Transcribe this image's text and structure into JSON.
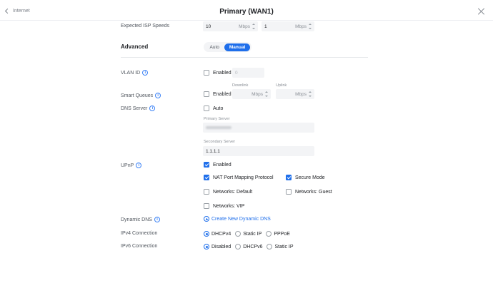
{
  "header": {
    "back_label": "Internet",
    "title": "Primary (WAN1)"
  },
  "isp": {
    "label": "Expected ISP Speeds",
    "download_value": "10",
    "download_unit": "Mbps",
    "upload_value": "1",
    "upload_unit": "Mbps"
  },
  "advanced": {
    "heading": "Advanced",
    "options": [
      "Auto",
      "Manual"
    ],
    "selected": "Manual"
  },
  "vlan": {
    "label": "VLAN ID",
    "enabled_label": "Enabled",
    "enabled": false,
    "value": "0"
  },
  "smart_queues": {
    "label": "Smart Queues",
    "enabled_label": "Enabled",
    "enabled": false,
    "download_label": "Downlink",
    "upload_label": "Uplink",
    "unit": "Mbps"
  },
  "dns": {
    "label": "DNS Server",
    "auto_label": "Auto",
    "auto": false,
    "primary_label": "Primary Server",
    "primary_value": "",
    "secondary_label": "Secondary Server",
    "secondary_value": "1.1.1.1"
  },
  "upnp": {
    "label": "UPnP",
    "enabled_label": "Enabled",
    "enabled": true,
    "options": [
      {
        "label": "NAT Port Mapping Protocol",
        "checked": true
      },
      {
        "label": "Secure Mode",
        "checked": true
      },
      {
        "label": "Networks: Default",
        "checked": false
      },
      {
        "label": "Networks: Guest",
        "checked": false
      },
      {
        "label": "Networks: VIP",
        "checked": false
      }
    ]
  },
  "ddns": {
    "label": "Dynamic DNS",
    "link": "Create New Dynamic DNS"
  },
  "ipv4": {
    "label": "IPv4 Connection",
    "options": [
      "DHCPv4",
      "Static IP",
      "PPPoE"
    ],
    "selected": "DHCPv4"
  },
  "ipv6": {
    "label": "IPv6 Connection",
    "options": [
      "Disabled",
      "DHCPv6",
      "Static IP"
    ],
    "selected": "Disabled"
  },
  "colors": {
    "accent": "#1f6feb",
    "text": "#50565e",
    "field_bg": "#f3f4f6"
  }
}
